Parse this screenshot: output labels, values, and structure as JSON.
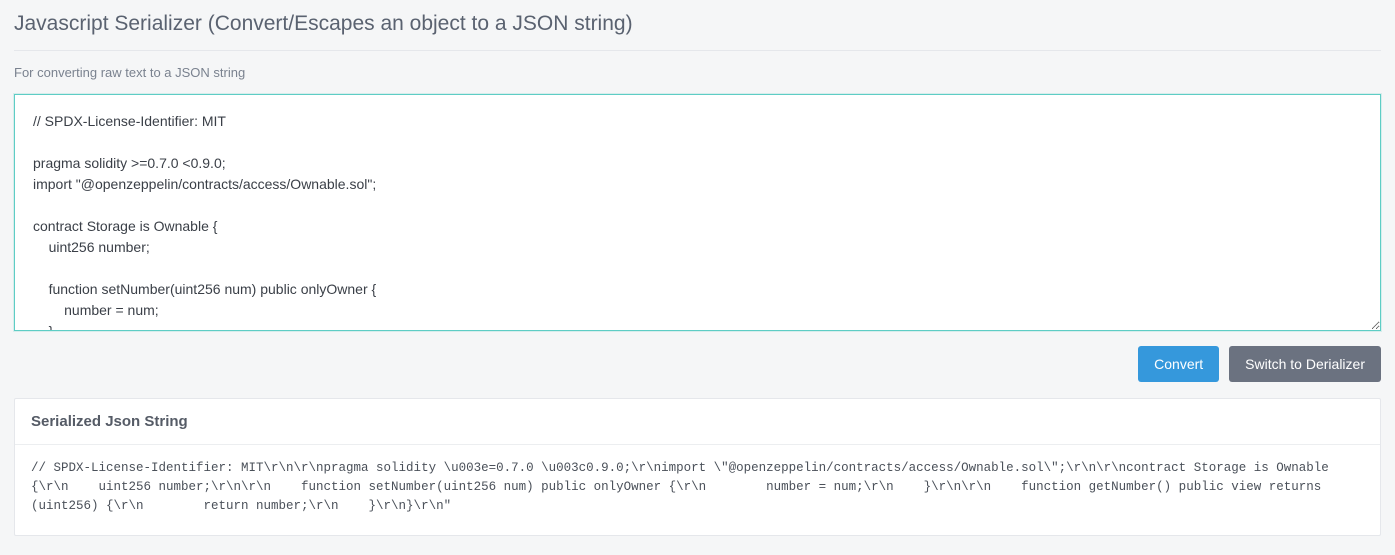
{
  "header": {
    "title": "Javascript Serializer (Convert/Escapes an object to a JSON string)",
    "subtitle": "For converting raw text to a JSON string"
  },
  "input": {
    "value": "// SPDX-License-Identifier: MIT\n\npragma solidity >=0.7.0 <0.9.0;\nimport \"@openzeppelin/contracts/access/Ownable.sol\";\n\ncontract Storage is Ownable {\n    uint256 number;\n\n    function setNumber(uint256 num) public onlyOwner {\n        number = num;\n    }"
  },
  "buttons": {
    "convert": "Convert",
    "switch": "Switch to Derializer"
  },
  "output": {
    "heading": "Serialized Json String",
    "content": "// SPDX-License-Identifier: MIT\\r\\n\\r\\npragma solidity \\u003e=0.7.0 \\u003c0.9.0;\\r\\nimport \\\"@openzeppelin/contracts/access/Ownable.sol\\\";\\r\\n\\r\\ncontract Storage is Ownable {\\r\\n    uint256 number;\\r\\n\\r\\n    function setNumber(uint256 num) public onlyOwner {\\r\\n        number = num;\\r\\n    }\\r\\n\\r\\n    function getNumber() public view returns (uint256) {\\r\\n        return number;\\r\\n    }\\r\\n}\\r\\n\""
  }
}
